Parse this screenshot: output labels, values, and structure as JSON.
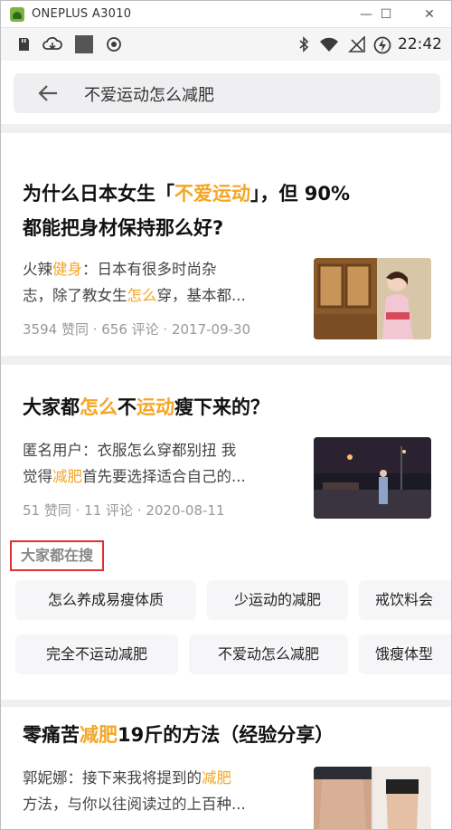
{
  "window": {
    "title": "ONEPLUS A3010",
    "minimize": "—",
    "maximize": "☐",
    "close": "✕"
  },
  "status_bar": {
    "time": "22:42"
  },
  "search": {
    "query": "不爱运动怎么减肥"
  },
  "results": [
    {
      "title_parts": [
        "为什么日本女生「",
        "不爱运动",
        "」，但 90%"
      ],
      "title_line2": "都能把身材保持那么好?",
      "snippet_line1_parts": [
        "火辣",
        "健身",
        "：日本有很多时尚杂"
      ],
      "snippet_line2_parts": [
        "志，除了教女生",
        "怎么",
        "穿，基本都..."
      ],
      "meta": "3594 赞同 · 656 评论 · 2017-09-30"
    },
    {
      "title_parts": [
        "大家都",
        "怎么",
        "不",
        "运动",
        "瘦下来的？"
      ],
      "snippet_line1": "匿名用户：衣服怎么穿都别扭 我",
      "snippet_line2_parts": [
        "觉得",
        "减肥",
        "首先要选择适合自己的..."
      ],
      "meta": "51 赞同 · 11 评论 · 2020-08-11"
    },
    {
      "title_parts": [
        "零痛苦",
        "减肥",
        "19斤的方法（经验分享）"
      ],
      "snippet_line1_parts": [
        "郭妮娜：接下来我将提到的",
        "减肥"
      ],
      "snippet_line2": "方法，与你以往阅读过的上百种..."
    }
  ],
  "trending": {
    "title": "大家都在搜",
    "chips": [
      "怎么养成易瘦体质",
      "少运动的减肥",
      "戒饮料会",
      "完全不运动减肥",
      "不爱动怎么减肥",
      "饿瘦体型"
    ]
  },
  "colors": {
    "highlight": "#f5a623",
    "annotation_box": "#e03030"
  }
}
